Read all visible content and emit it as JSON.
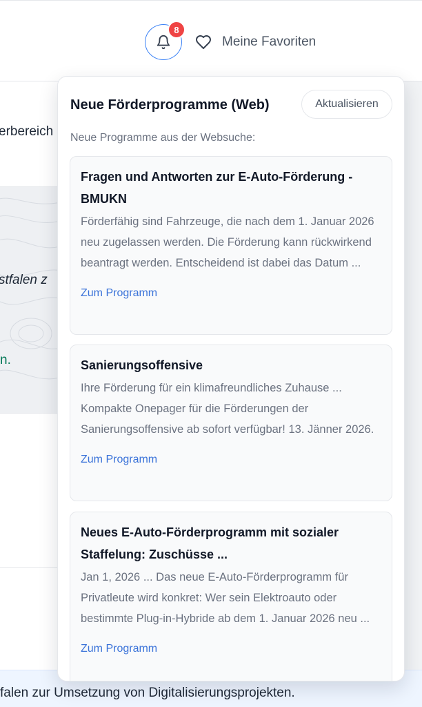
{
  "header": {
    "notification_count": "8",
    "favorites_label": "Meine Favoriten"
  },
  "background": {
    "text_1": "erbereich",
    "text_2": "stfalen z",
    "text_3": "n.",
    "bottom_text": "falen zur Umsetzung von Digitalisierungsprojekten."
  },
  "panel": {
    "title": "Neue Förderprogramme (Web)",
    "refresh_label": "Aktualisieren",
    "subtitle": "Neue Programme aus der Websuche:",
    "items": [
      {
        "title": "Fragen und Antworten zur E-Auto-Förderung - BMUKN",
        "description": "Förderfähig sind Fahrzeuge, die nach dem 1. Januar 2026 neu zugelassen werden. Die Förderung kann rückwirkend beantragt werden. Entscheidend ist dabei das Datum ...",
        "link_label": "Zum Programm"
      },
      {
        "title": "Sanierungsoffensive",
        "description": "Ihre Förderung für ein klimafreundliches Zuhause ... Kompakte Onepager für die Förderungen der Sanierungsoffensive ab sofort verfügbar! 13. Jänner 2026.",
        "link_label": "Zum Programm"
      },
      {
        "title": "Neues E-Auto-Förderprogramm mit sozialer Staffelung: Zuschüsse ...",
        "description": "Jan 1, 2026 ... Das neue E-Auto-Förderprogramm für Privatleute wird konkret: Wer sein Elektroauto oder bestimmte Plug-in-Hybride ab dem 1. Januar 2026 neu ...",
        "link_label": "Zum Programm"
      }
    ]
  },
  "icons": {
    "bell": "bell-icon",
    "heart": "heart-icon"
  },
  "colors": {
    "accent": "#3b82f6",
    "badge": "#ef4444",
    "link": "#3b73d9"
  }
}
